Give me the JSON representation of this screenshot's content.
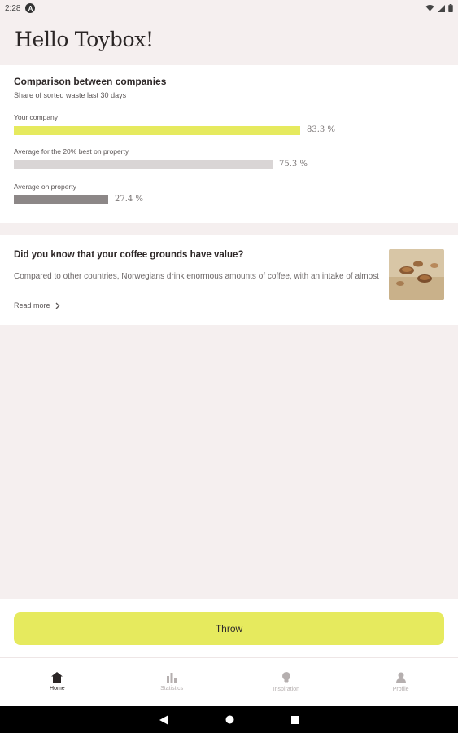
{
  "status_bar": {
    "time": "2:28",
    "notification_badge": "A"
  },
  "header": {
    "greeting": "Hello Toybox!"
  },
  "comparison": {
    "title": "Comparison between companies",
    "subtitle": "Share of sorted waste last 30 days",
    "bars": [
      {
        "label": "Your company",
        "value": 83.3,
        "value_text": "83.3 %",
        "color": "#e6ea5e"
      },
      {
        "label": "Average for the 20% best on property",
        "value": 75.3,
        "value_text": "75.3 %",
        "color": "#d9d5d5"
      },
      {
        "label": "Average on property",
        "value": 27.4,
        "value_text": "27.4 %",
        "color": "#8c8787"
      }
    ]
  },
  "article": {
    "title": "Did you know that your coffee grounds have value?",
    "body": "Compared to other countries, Norwegians drink enormous amounts of coffee, with an intake of almost",
    "read_more": "Read more",
    "image_icon": "coffee-grounds-photo"
  },
  "actions": {
    "throw_label": "Throw"
  },
  "bottom_nav": {
    "items": [
      {
        "label": "Home",
        "icon": "home-icon",
        "active": true
      },
      {
        "label": "Statistics",
        "icon": "bar-chart-icon",
        "active": false
      },
      {
        "label": "Inspiration",
        "icon": "lightbulb-icon",
        "active": false
      },
      {
        "label": "Profile",
        "icon": "person-icon",
        "active": false
      }
    ]
  },
  "theme": {
    "accent": "#e6ea5e",
    "background": "#f5efef",
    "card": "#ffffff",
    "text": "#2b2626"
  }
}
